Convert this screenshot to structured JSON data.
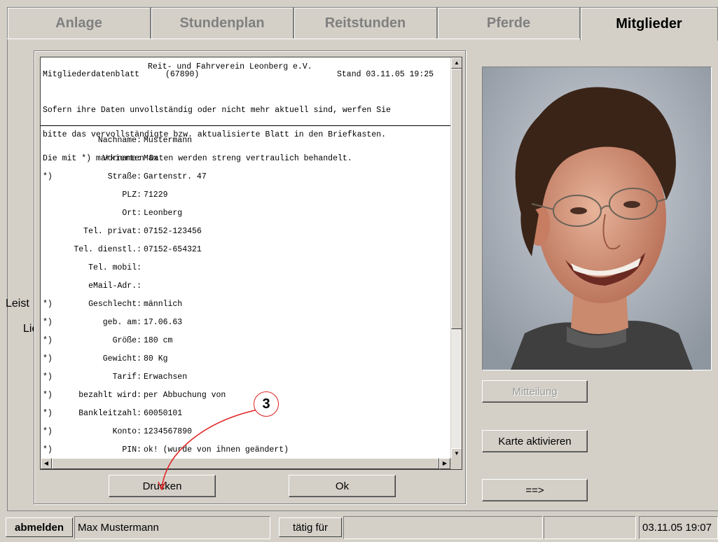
{
  "tabs": [
    {
      "label": "Anlage",
      "active": false
    },
    {
      "label": "Stundenplan",
      "active": false
    },
    {
      "label": "Reitstunden",
      "active": false
    },
    {
      "label": "Pferde",
      "active": false
    },
    {
      "label": "Mitglieder",
      "active": true
    }
  ],
  "background_labels": {
    "leist": "Leist",
    "lie": "Lie"
  },
  "document": {
    "club_name": "Reit- und Fahrverein Leonberg e.V.",
    "sheet_title": "Mitgliederdatenblatt",
    "member_id": "(67890)",
    "stand": "Stand 03.11.05 19:25",
    "note_line1": "Sofern ihre Daten unvollständig oder nicht mehr aktuell sind, werfen Sie",
    "note_line2": "bitte das vervollständigte bzw. aktualisierte Blatt in den Briefkasten.",
    "note_line3": "Die mit *) markierten Daten werden streng vertraulich behandelt.",
    "fields": [
      {
        "mark": "",
        "label": "Nachname:",
        "value": "Mustermann"
      },
      {
        "mark": "",
        "label": "Vorname:",
        "value": "Max"
      },
      {
        "mark": "*)",
        "label": "Straße:",
        "value": "Gartenstr. 47"
      },
      {
        "mark": "",
        "label": "PLZ:",
        "value": "71229"
      },
      {
        "mark": "",
        "label": "Ort:",
        "value": "Leonberg"
      },
      {
        "mark": "",
        "label": "Tel. privat:",
        "value": "07152-123456"
      },
      {
        "mark": "",
        "label": "Tel. dienstl.:",
        "value": "07152-654321"
      },
      {
        "mark": "",
        "label": "Tel. mobil:",
        "value": ""
      },
      {
        "mark": "",
        "label": "eMail-Adr.:",
        "value": ""
      },
      {
        "mark": "*)",
        "label": "Geschlecht:",
        "value": "männlich"
      },
      {
        "mark": "*)",
        "label": "geb. am:",
        "value": "17.06.63"
      },
      {
        "mark": "*)",
        "label": "Größe:",
        "value": "180 cm"
      },
      {
        "mark": "*)",
        "label": "Gewicht:",
        "value": "80 Kg"
      },
      {
        "mark": "*)",
        "label": "Tarif:",
        "value": "Erwachsen"
      },
      {
        "mark": "*)",
        "label": "bezahlt wird:",
        "value": "per Abbuchung von"
      },
      {
        "mark": "*)",
        "label": "Bankleitzahl:",
        "value": "60050101"
      },
      {
        "mark": "*)",
        "label": "Konto:",
        "value": "1234567890"
      },
      {
        "mark": "*)",
        "label": "PIN:",
        "value": "ok! (wurde von ihnen geändert)"
      }
    ]
  },
  "dialog_buttons": {
    "print": "Drucken",
    "ok": "Ok"
  },
  "side_buttons": {
    "message": "Mitteilung",
    "activate_card": "Karte aktivieren",
    "next": "==>"
  },
  "annotation": {
    "number": "3",
    "color": "#e02020"
  },
  "statusbar": {
    "logout": "abmelden",
    "user": "Max Mustermann",
    "active_for": "tätig für",
    "datetime": "03.11.05 19:07"
  }
}
